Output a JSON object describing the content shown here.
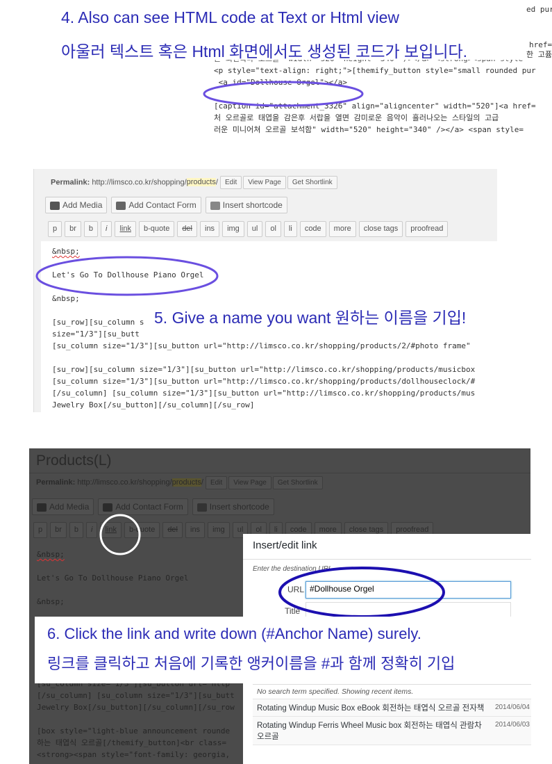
{
  "step4": {
    "title_en": "4. Also can see HTML code at Text or Html view",
    "title_ko": "아울러 텍스트 혹은 Html 화면에서도 생성된 코드가 보입니다.",
    "top_right_lines": [
      "ed pur",
      "href=",
      "한 고퓸"
    ],
    "code_lines": [
      "<p style=\"text-align: right;\">[themify_button style=\"small rounded pur",
      " <a id=\"Dollhouse Orgel\"></a>",
      "",
      "[caption id=\"attachment_3326\" align=\"aligncenter\" width=\"520\"]<a href=",
      "처 오르골로 태엽을 감은후 서랍을 열면 감미로운 음악이 흘러나오는 스타일의 고급",
      "러운 미니어쳐 오르골 보석함\" width=\"520\" height=\"340\" /></a> <span style="
    ],
    "partial_line": "른 회전목마 오르골\" width=\"520\" height=\"340\" /></a> <strong><span style="
  },
  "step5": {
    "caption": "5. Give a name you want   원하는 이름을 기입!",
    "permalink_label": "Permalink:",
    "permalink_base": "http://limsco.co.kr/shopping/",
    "permalink_slug": "products",
    "permalink_tail": "/",
    "permalink_buttons": [
      "Edit",
      "View Page",
      "Get Shortlink"
    ],
    "media_buttons": [
      "Add Media",
      "Add Contact Form",
      "Insert shortcode"
    ],
    "quicktags": [
      "p",
      "br",
      "b",
      "i",
      "link",
      "b-quote",
      "del",
      "ins",
      "img",
      "ul",
      "ol",
      "li",
      "code",
      "more",
      "close tags",
      "proofread"
    ],
    "editor_lines": [
      "&nbsp;",
      "",
      "Let's Go To Dollhouse Piano Orgel",
      "",
      "&nbsp;",
      "",
      "[su_row][su_column s",
      "size=\"1/3\"][su_butt",
      "[su_column size=\"1/3\"][su_button url=\"http://limsco.co.kr/shopping/products/2/#photo frame\"",
      "",
      "[su_row][su_column size=\"1/3\"][su_button url=\"http://limsco.co.kr/shopping/products/musicbox",
      "[su_column size=\"1/3\"][su_button url=\"http://limsco.co.kr/shopping/products/dollhouseclock/#",
      "[/su_column] [su_column size=\"1/3\"][su_button url=\"http://limsco.co.kr/shopping/products/mus",
      "Jewelry Box[/su_button][/su_column][/su_row]"
    ]
  },
  "step6": {
    "page_title": "Products(L)",
    "permalink_label": "Permalink:",
    "permalink_base": "http://limsco.co.kr/shopping/",
    "permalink_slug": "products",
    "permalink_tail": "/",
    "permalink_buttons": [
      "Edit",
      "View Page",
      "Get Shortlink"
    ],
    "media_buttons": [
      "Add Media",
      "Add Contact Form",
      "Insert shortcode"
    ],
    "quicktags": [
      "p",
      "br",
      "b",
      "i",
      "link",
      "b-quote",
      "del",
      "ins",
      "img",
      "ul",
      "ol",
      "li",
      "code",
      "more",
      "close tags",
      "proofread"
    ],
    "editor_lines": [
      "&nbsp;",
      "",
      "Let's Go To Dollhouse Piano Orgel",
      "",
      "&nbsp;"
    ],
    "editor_lines_bottom": [
      "[su_column size=\"1/3\"][su_button url=\"http",
      "[/su_column] [su_column size=\"1/3\"][su_butt",
      "Jewelry Box[/su_button][/su_column][/su_row",
      "",
      "[box style=\"light-blue announcement rounde",
      "하는 태엽식 오르골[/themify_button]<br class=",
      "<strong><span style=\"font-family: georgia,"
    ],
    "modal": {
      "title": "Insert/edit link",
      "hint": "Enter the destination URL",
      "url_label": "URL",
      "url_value": "#Dollhouse Orgel",
      "title_label": "Title",
      "title_value": "",
      "search_notice": "No search term specified. Showing recent items.",
      "results": [
        {
          "title": "Rotating Windup Music Box eBook 회전하는 태엽식 오르골 전자책",
          "date": "2014/06/04"
        },
        {
          "title": "Rotating Windup Ferris Wheel Music box 회전하는 태엽식 관람차 오르골",
          "date": "2014/06/03"
        }
      ]
    },
    "caption_en": "6. Click the link and write down (#Anchor Name) surely.",
    "caption_ko": "링크를 클릭하고 처음에 기록한 앵커이름을 #과 함께 정확히 기입"
  },
  "colors": {
    "caption_blue": "#2b2bb5",
    "ellipse_purple": "#6a4fe0",
    "ellipse_navy": "#1c0fb0",
    "slug_highlight": "#fff7c4",
    "overlay_dark": "#4b4b4b"
  }
}
